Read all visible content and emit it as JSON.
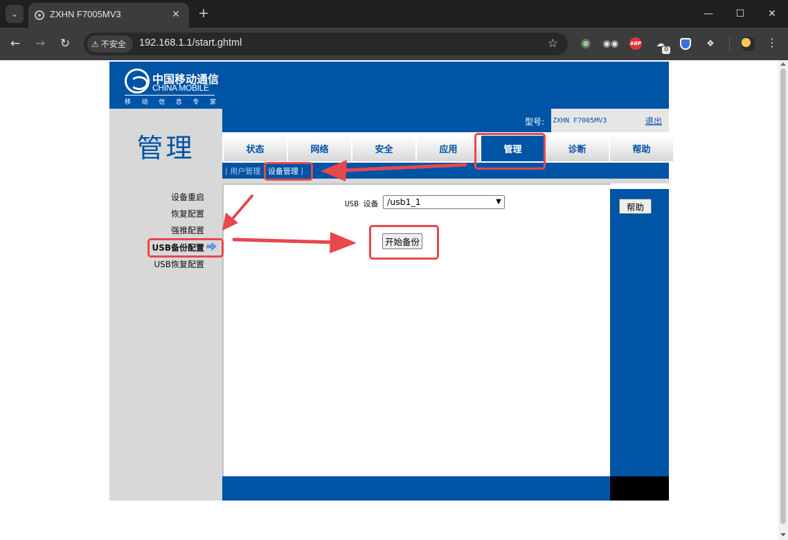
{
  "browser": {
    "tab_title": "ZXHN F7005MV3",
    "security_label": "不安全",
    "url": "192.168.1.1/start.ghtml",
    "extension_badge": "0"
  },
  "logo": {
    "name_cn": "中国移动通信",
    "name_en": "CHINA MOBILE",
    "tagline_chars": [
      "移",
      "动",
      "信",
      "息",
      "专",
      "家"
    ]
  },
  "section_title": "管理",
  "model": {
    "label": "型号:",
    "value": "ZXHN F7005MV3",
    "logout": "退出"
  },
  "nav_tabs": [
    {
      "label": "状态",
      "active": false
    },
    {
      "label": "网络",
      "active": false
    },
    {
      "label": "安全",
      "active": false
    },
    {
      "label": "应用",
      "active": false
    },
    {
      "label": "管理",
      "active": true
    },
    {
      "label": "诊断",
      "active": false
    },
    {
      "label": "帮助",
      "active": false
    }
  ],
  "sub_nav": {
    "items": [
      "用户管理",
      "设备管理"
    ],
    "current": "设备管理"
  },
  "sidebar": {
    "items": [
      {
        "label": "设备重启",
        "active": false
      },
      {
        "label": "恢复配置",
        "active": false
      },
      {
        "label": "强推配置",
        "active": false
      },
      {
        "label": "USB备份配置",
        "active": true
      },
      {
        "label": "USB恢复配置",
        "active": false
      }
    ]
  },
  "form": {
    "usb_label": "USB 设备",
    "usb_selected": "/usb1_1",
    "backup_button": "开始备份"
  },
  "help_button": "帮助",
  "colors": {
    "brand_blue": "#0054a6",
    "annotation_red": "#e8474b",
    "panel_gray": "#d8d8d8"
  }
}
